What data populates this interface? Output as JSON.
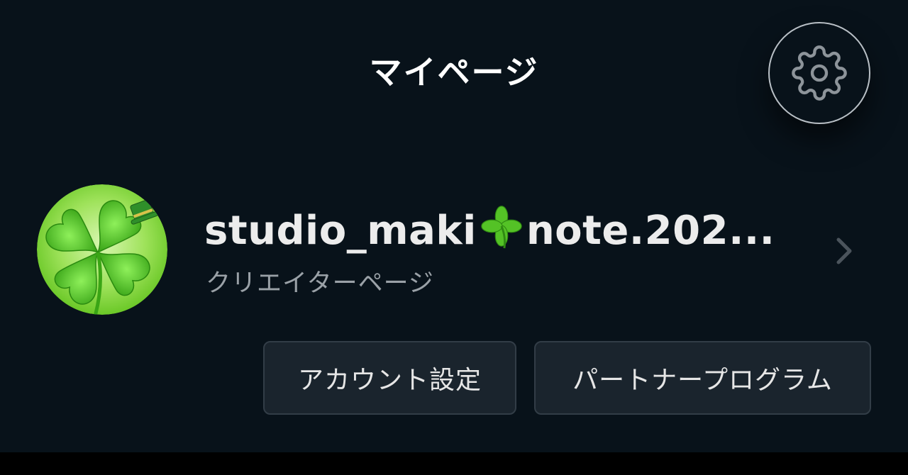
{
  "header": {
    "title": "マイページ",
    "settings_icon": "gear-icon"
  },
  "profile": {
    "name_part1": "studio_maki",
    "name_emoji_icon": "four-leaf-clover-icon",
    "name_part2": "note.202...",
    "subtitle": "クリエイターページ",
    "avatar_icon": "clover-avatar",
    "chevron_icon": "chevron-right-icon"
  },
  "actions": {
    "account_settings_label": "アカウント設定",
    "partner_program_label": "パートナープログラム"
  },
  "colors": {
    "background": "#08121a",
    "button_bg": "#1a242d",
    "button_border": "#323d47",
    "accent_green": "#4fc21a",
    "title_text": "#ffffff",
    "secondary_text": "#9aa1a7"
  }
}
